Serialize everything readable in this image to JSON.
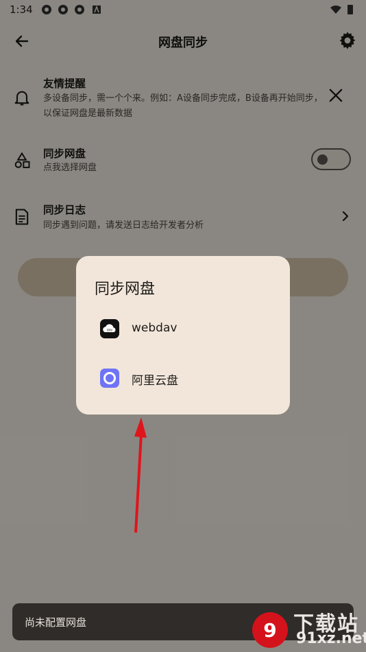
{
  "status": {
    "time": "1:34"
  },
  "header": {
    "title": "网盘同步"
  },
  "rows": {
    "reminder": {
      "title": "友情提醒",
      "desc": "多设备同步，需一个个来。例如：A设备同步完成，B设备再开始同步，以保证网盘是最新数据"
    },
    "sync_disk": {
      "title": "同步网盘",
      "desc": "点我选择网盘",
      "toggle_on": false
    },
    "sync_log": {
      "title": "同步日志",
      "desc": "同步遇到问题，请发送日志给开发者分析"
    }
  },
  "dialog": {
    "title": "同步网盘",
    "options": [
      {
        "label": "webdav",
        "icon": "webdav-cloud-icon"
      },
      {
        "label": "阿里云盘",
        "icon": "aliyun-drive-icon"
      }
    ]
  },
  "snackbar": {
    "text": "尚未配置网盘"
  },
  "watermark": {
    "main": "下载站",
    "sub": "91xz.net"
  },
  "colors": {
    "background": "#f7f1e8",
    "dialog": "#f2e6da",
    "accent": "#d9c8ad",
    "arrow": "#e0141c"
  }
}
